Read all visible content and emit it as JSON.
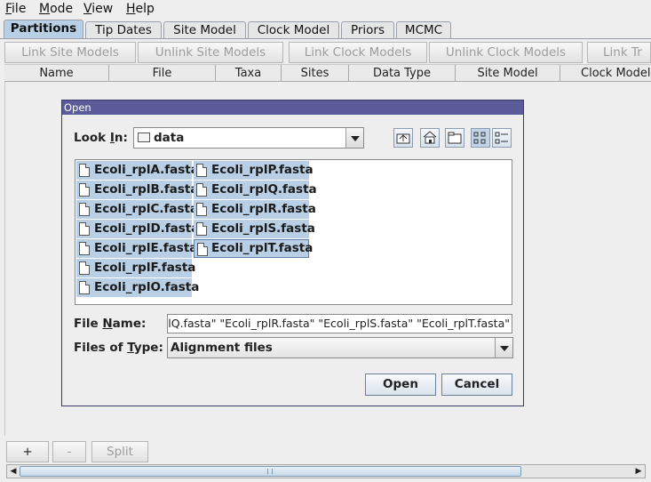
{
  "menubar": {
    "items": [
      {
        "label": "File",
        "mnemonic": "F",
        "rest": "ile"
      },
      {
        "label": "Mode",
        "mnemonic": "M",
        "rest": "ode"
      },
      {
        "label": "View",
        "mnemonic": "V",
        "rest": "iew"
      },
      {
        "label": "Help",
        "mnemonic": "H",
        "rest": "elp"
      }
    ]
  },
  "tabs": [
    "Partitions",
    "Tip Dates",
    "Site Model",
    "Clock Model",
    "Priors",
    "MCMC"
  ],
  "toolbar": {
    "link_site": "Link Site Models",
    "unlink_site": "Unlink Site Models",
    "link_clock": "Link Clock Models",
    "unlink_clock": "Unlink Clock Models",
    "link_trees": "Link Tr"
  },
  "table": {
    "columns": [
      "Name",
      "File",
      "Taxa",
      "Sites",
      "Data Type",
      "Site Model",
      "Clock Model"
    ]
  },
  "bottom": {
    "add": "+",
    "remove": "-",
    "split": "Split"
  },
  "dialog": {
    "title": "Open",
    "look_in_label_pre": "Look ",
    "look_in_mnemonic": "I",
    "look_in_label_post": "n:",
    "look_in_value": "data",
    "files": [
      "Ecoli_rplA.fasta",
      "Ecoli_rplB.fasta",
      "Ecoli_rplC.fasta",
      "Ecoli_rplD.fasta",
      "Ecoli_rplE.fasta",
      "Ecoli_rplF.fasta",
      "Ecoli_rplO.fasta",
      "Ecoli_rplP.fasta",
      "Ecoli_rplQ.fasta",
      "Ecoli_rplR.fasta",
      "Ecoli_rplS.fasta",
      "Ecoli_rplT.fasta"
    ],
    "file_name_label_pre": "File ",
    "file_name_mnemonic": "N",
    "file_name_label_post": "ame:",
    "file_name_value": "plQ.fasta\" \"Ecoli_rplR.fasta\" \"Ecoli_rplS.fasta\" \"Ecoli_rplT.fasta\"",
    "file_type_label_pre": "Files of ",
    "file_type_mnemonic": "T",
    "file_type_label_post": "ype:",
    "file_type_value": "Alignment files",
    "open_button": "Open",
    "cancel_button": "Cancel",
    "icons": [
      "up-one-level-icon",
      "home-icon",
      "new-folder-icon",
      "list-view-icon",
      "details-view-icon"
    ]
  }
}
